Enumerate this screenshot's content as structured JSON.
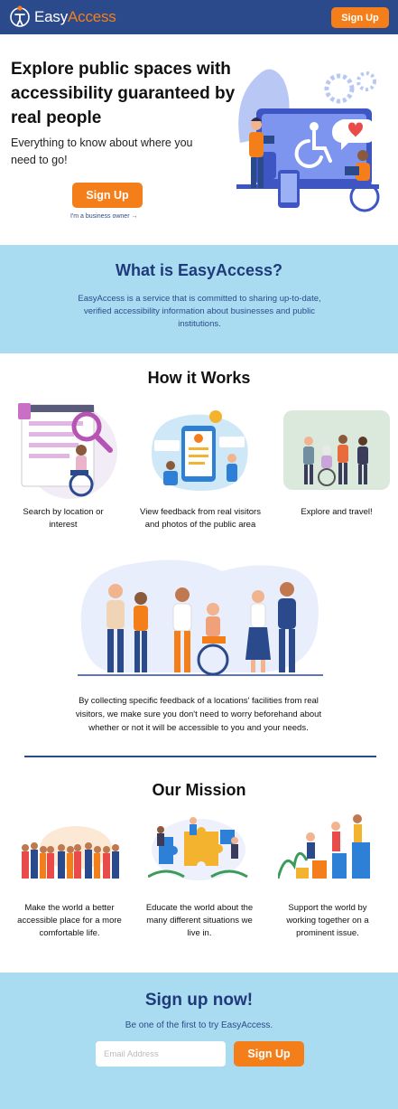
{
  "header": {
    "logo_part1": "Easy",
    "logo_part2": "Access",
    "signup_label": "Sign Up"
  },
  "hero": {
    "title": "Explore public spaces with accessibility guaranteed by real people",
    "subtitle": "Everything to know about where you need to go!",
    "signup_label": "Sign Up",
    "business_link": "I'm a business owner →"
  },
  "what": {
    "title": "What is EasyAccess?",
    "text": "EasyAccess is a service that is committed to sharing up-to-date, verified accessibility information about businesses and public institutions."
  },
  "how": {
    "title": "How it Works",
    "steps": [
      {
        "caption": "Search by location or interest"
      },
      {
        "caption": "View feedback from real visitors and photos of the public area"
      },
      {
        "caption": "Explore and travel!"
      }
    ],
    "collect_text": "By collecting specific feedback of a locations' facilities from real visitors, we make sure you don't need to worry beforehand about whether or not it will be accessible to you and your needs."
  },
  "mission": {
    "title": "Our Mission",
    "items": [
      {
        "caption": "Make the world a better accessible place for a more comfortable life."
      },
      {
        "caption": "Educate the world about the many different situations we live in."
      },
      {
        "caption": "Support the world by working together on a prominent issue."
      }
    ]
  },
  "signup": {
    "title": "Sign up now!",
    "subtitle": "Be one of the first to try EasyAccess.",
    "email_placeholder": "Email Address",
    "button_label": "Sign Up"
  },
  "colors": {
    "navy": "#2b4a8b",
    "orange": "#f47f1a",
    "light_blue": "#a9dcf1"
  }
}
